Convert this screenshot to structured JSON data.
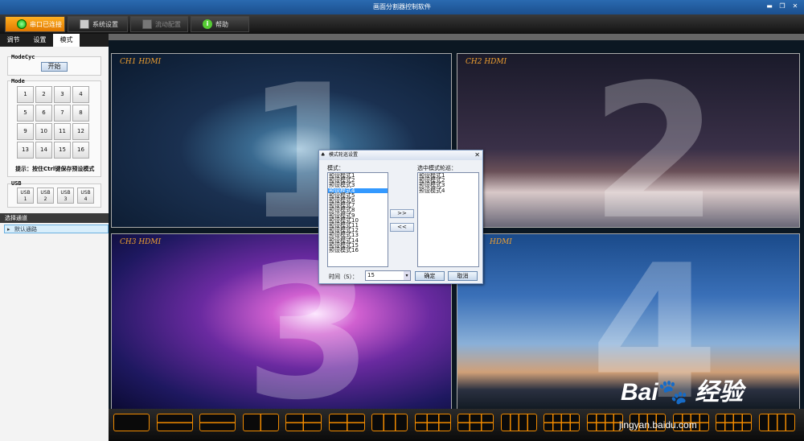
{
  "window": {
    "title": "画面分割器控制软件",
    "min": "▬",
    "max": "❐",
    "close": "✕"
  },
  "toolbar": {
    "items": [
      {
        "label": "串口已连接",
        "icon": "connected-icon"
      },
      {
        "label": "系统设置",
        "icon": "monitor-icon"
      },
      {
        "label": "流动配置",
        "icon": "monitor-icon"
      },
      {
        "label": "帮助",
        "icon": "info-icon"
      }
    ]
  },
  "left": {
    "tabs": [
      "调节",
      "设置",
      "模式"
    ],
    "active_tab": 2,
    "modecyc_label": "ModeCyc",
    "start_button": "开始",
    "mode_label": "Mode",
    "modes": [
      "1",
      "2",
      "3",
      "4",
      "5",
      "6",
      "7",
      "8",
      "9",
      "10",
      "11",
      "12",
      "13",
      "14",
      "15",
      "16"
    ],
    "hint": "提示：按住Ctrl键保存预设模式",
    "usb_label": "USB",
    "usb_buttons": [
      [
        "USB",
        "1"
      ],
      [
        "USB",
        "2"
      ],
      [
        "USB",
        "3"
      ],
      [
        "USB",
        "4"
      ]
    ],
    "channel_header": "选择通道",
    "channel_item": "默认通路"
  },
  "panels": [
    {
      "label": "CH1   HDMI",
      "number": "1"
    },
    {
      "label": "CH2   HDMI",
      "number": "2"
    },
    {
      "label": "CH3   HDMI",
      "number": "3"
    },
    {
      "label": "HDMI",
      "number": "4"
    }
  ],
  "dialog": {
    "title": "模式轮巡设置",
    "left_label": "模式：",
    "right_label": "选中模式轮巡：",
    "modes": [
      "预设模式1",
      "预设模式2",
      "预设模式3",
      "预设模式4",
      "预设模式5",
      "预设模式6",
      "预设模式7",
      "预设模式8",
      "预设模式9",
      "预设模式10",
      "预设模式11",
      "预设模式12",
      "预设模式13",
      "预设模式14",
      "预设模式15",
      "预设模式16"
    ],
    "selected_index": 3,
    "selected_modes": [
      "预设模式1",
      "预设模式2",
      "预设模式3",
      "预设模式4"
    ],
    "add_button": ">>",
    "remove_button": "<<",
    "time_label": "时间（S）：",
    "time_value": "15",
    "ok_button": "确定",
    "cancel_button": "取消"
  },
  "layout_buttons_count": 16,
  "watermark": {
    "text": "Bai 经验",
    "url": "jingyan.baidu.com"
  }
}
